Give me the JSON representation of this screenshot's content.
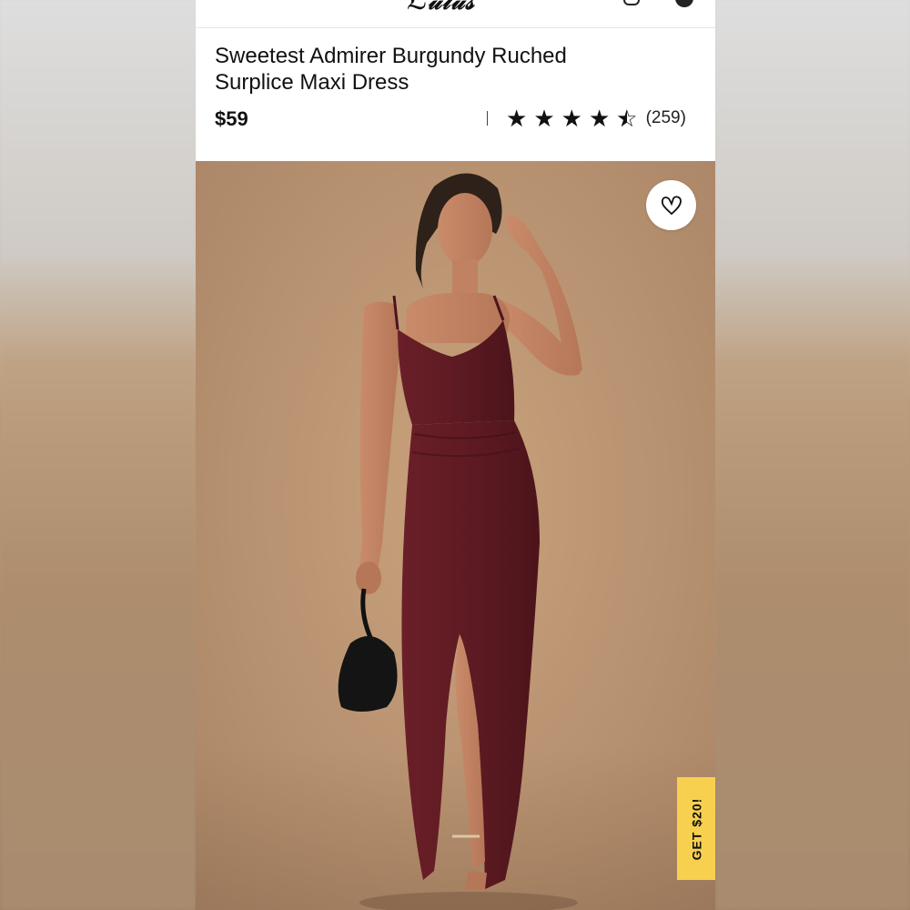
{
  "product": {
    "title": "Sweetest Admirer Burgundy Ruched Surplice Maxi Dress",
    "price": "$59",
    "rating": {
      "stars": 4.5,
      "max": 5,
      "review_count": "(259)"
    }
  },
  "promo": {
    "label": "GET $20!"
  },
  "icons": {
    "wishlist": "heart-icon",
    "star": "star-icon"
  },
  "colors": {
    "dress": "#5e1a22",
    "promo_bg": "#f7d04f",
    "background_tan": "#bb9573"
  }
}
